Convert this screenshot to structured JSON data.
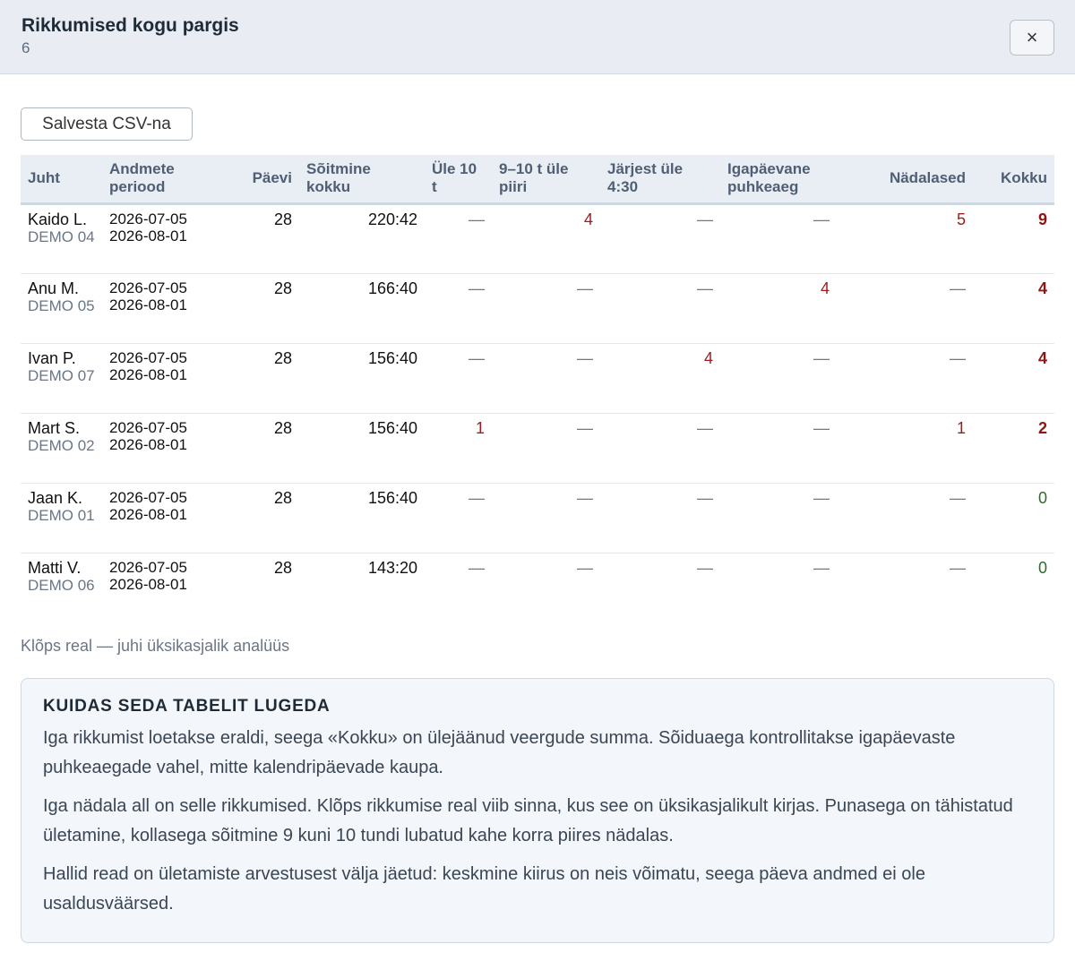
{
  "dialog": {
    "title": "Rikkumised kogu pargis",
    "count": "6",
    "close_label": "×",
    "csv_button": "Salvesta CSV-na"
  },
  "table": {
    "headers": [
      "Juht",
      "Andmete periood",
      "Päevi",
      "Sõitmine kokku",
      "Üle 10 t",
      "9–10 t üle piiri",
      "Järjest üle 4:30",
      "Igapäevane puhkeaeg",
      "Nädalased",
      "Kokku"
    ],
    "rows": [
      {
        "driver": "Kaido L.",
        "plate": "DEMO 04",
        "from": "2026-07-05",
        "to": "2026-08-01",
        "days": "28",
        "driving": "220:42",
        "over10": "—",
        "over9_10": "4",
        "cont": "—",
        "rest": "—",
        "weekly": "5",
        "total": "9"
      },
      {
        "driver": "Anu M.",
        "plate": "DEMO 05",
        "from": "2026-07-05",
        "to": "2026-08-01",
        "days": "28",
        "driving": "166:40",
        "over10": "—",
        "over9_10": "—",
        "cont": "—",
        "rest": "4",
        "weekly": "—",
        "total": "4"
      },
      {
        "driver": "Ivan P.",
        "plate": "DEMO 07",
        "from": "2026-07-05",
        "to": "2026-08-01",
        "days": "28",
        "driving": "156:40",
        "over10": "—",
        "over9_10": "—",
        "cont": "4",
        "rest": "—",
        "weekly": "—",
        "total": "4"
      },
      {
        "driver": "Mart S.",
        "plate": "DEMO 02",
        "from": "2026-07-05",
        "to": "2026-08-01",
        "days": "28",
        "driving": "156:40",
        "over10": "1",
        "over9_10": "—",
        "cont": "—",
        "rest": "—",
        "weekly": "1",
        "total": "2"
      },
      {
        "driver": "Jaan K.",
        "plate": "DEMO 01",
        "from": "2026-07-05",
        "to": "2026-08-01",
        "days": "28",
        "driving": "156:40",
        "over10": "—",
        "over9_10": "—",
        "cont": "—",
        "rest": "—",
        "weekly": "—",
        "total": "0"
      },
      {
        "driver": "Matti V.",
        "plate": "DEMO 06",
        "from": "2026-07-05",
        "to": "2026-08-01",
        "days": "28",
        "driving": "143:20",
        "over10": "—",
        "over9_10": "—",
        "cont": "—",
        "rest": "—",
        "weekly": "—",
        "total": "0"
      }
    ]
  },
  "hint": "Klõps real — juhi üksikasjalik analüüs",
  "info": {
    "title": "KUIDAS SEDA TABELIT LUGEDA",
    "paragraphs": [
      "Iga rikkumist loetakse eraldi, seega «Kokku» on ülejäänud veergude summa. Sõiduaega kontrollitakse igapäevaste puhkeaegade vahel, mitte kalendripäevade kaupa.",
      "Iga nädala all on selle rikkumised. Klõps rikkumise real viib sinna, kus see on üksikasjalikult kirjas. Punasega on tähistatud ületamine, kollasega sõitmine 9 kuni 10 tundi lubatud kahe korra piires nädalas.",
      "Hallid read on ületamiste arvestusest välja jäetud: keskmine kiirus on neis võimatu, seega päeva andmed ei ole usaldusväärsed."
    ]
  },
  "colors": {
    "violation": "#9b1c1c",
    "zero_total": "#2e6b2e",
    "header_bg": "#e9edf3"
  }
}
